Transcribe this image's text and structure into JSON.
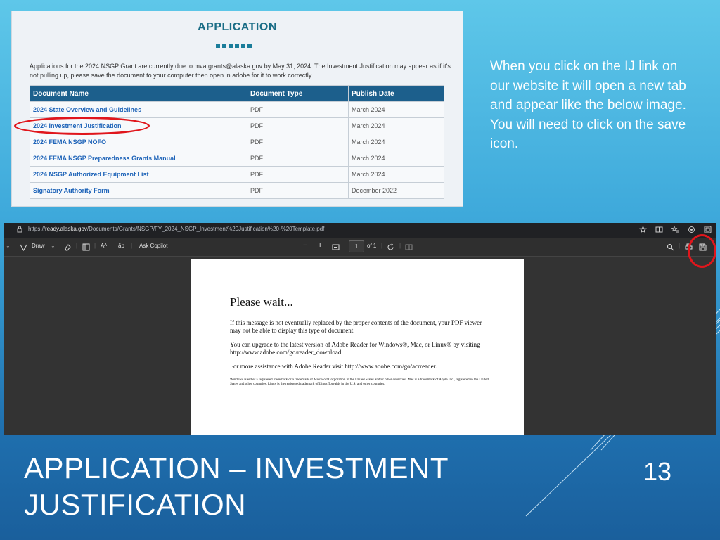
{
  "app_screenshot": {
    "title": "APPLICATION",
    "note": "Applications for the 2024 NSGP Grant are currently due to mva.grants@alaska.gov by May 31, 2024.  The Investment Justification may appear as if it's not pulling up, please save the document to your computer then open in adobe for it to work correctly.",
    "columns": [
      "Document Name",
      "Document Type",
      "Publish Date"
    ],
    "rows": [
      [
        "2024 State Overview and Guidelines",
        "PDF",
        "March 2024"
      ],
      [
        "2024 Investment Justification",
        "PDF",
        "March 2024"
      ],
      [
        "2024 FEMA NSGP NOFO",
        "PDF",
        "March 2024"
      ],
      [
        "2024 FEMA NSGP Preparedness Grants Manual",
        "PDF",
        "March 2024"
      ],
      [
        "2024 NSGP Authorized Equipment List",
        "PDF",
        "March 2024"
      ],
      [
        "Signatory Authority Form",
        "PDF",
        "December 2022"
      ]
    ]
  },
  "callout": "When you click on the IJ link on our website it will open a new tab and appear like the below image.  You will need to click on the save icon.",
  "browser": {
    "url_prefix": "https://",
    "url_host": "ready.alaska.gov",
    "url_path": "/Documents/Grants/NSGP/FY_2024_NSGP_Investment%20Justification%20-%20Template.pdf",
    "draw_label": "Draw",
    "ask_copilot_label": "Ask Copilot",
    "minus": "−",
    "plus": "+",
    "page_number": "1",
    "page_of": "of 1"
  },
  "pdf": {
    "heading": "Please wait...",
    "para1": "If this message is not eventually replaced by the proper contents of the document, your PDF viewer may not be able to display this type of document.",
    "para2": "You can upgrade to the latest version of Adobe Reader for Windows®, Mac, or Linux® by visiting  http://www.adobe.com/go/reader_download.",
    "para3": "For more assistance with Adobe Reader visit  http://www.adobe.com/go/acrreader.",
    "fine_print": "Windows is either a registered trademark or a trademark of Microsoft Corporation in the United States and/or other countries. Mac is a trademark of Apple Inc., registered in the United States and other countries. Linux is the registered trademark of Linus Torvalds in the U.S. and other countries."
  },
  "slide": {
    "title_line1": "APPLICATION – INVESTMENT",
    "title_line2": "JUSTIFICATION",
    "number": "13"
  },
  "colors": {
    "highlight_circle": "#e0161c",
    "table_header": "#1c5f8c",
    "link_text": "#1d63b8",
    "app_title": "#1a6d86"
  }
}
